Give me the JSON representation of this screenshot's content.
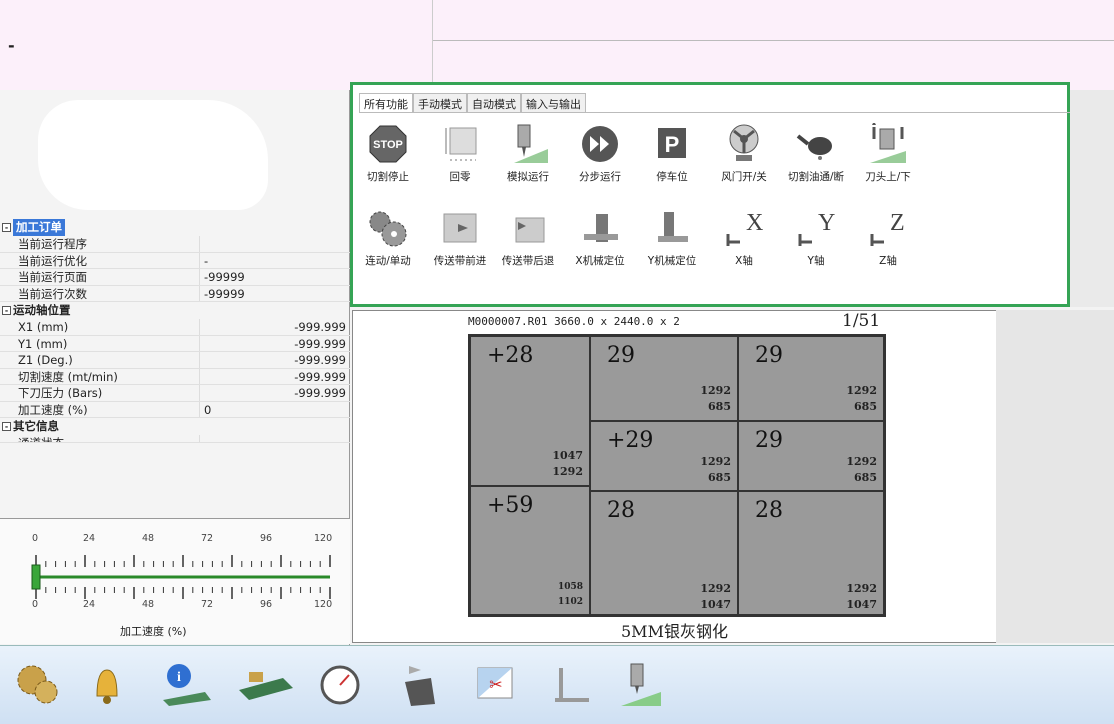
{
  "header": {
    "left_text": "-"
  },
  "tree": {
    "sections": [
      {
        "label": "加工订单",
        "rows": [
          {
            "k": "当前运行程序",
            "v": ""
          },
          {
            "k": "当前运行优化",
            "v": "-"
          },
          {
            "k": "当前运行页面",
            "v": "-99999"
          },
          {
            "k": "当前运行次数",
            "v": "-99999"
          }
        ]
      },
      {
        "label": "运动轴位置",
        "rows": [
          {
            "k": "X1 (mm)",
            "v": "-999.999"
          },
          {
            "k": "Y1 (mm)",
            "v": "-999.999"
          },
          {
            "k": "Z1 (Deg.)",
            "v": "-999.999"
          },
          {
            "k": "切割速度 (mt/min)",
            "v": "-999.999"
          },
          {
            "k": "下刀压力 (Bars)",
            "v": "-999.999"
          },
          {
            "k": "加工速度 (%)",
            "v": "0"
          }
        ]
      },
      {
        "label": "其它信息",
        "rows": [
          {
            "k": "通道状态",
            "v": ""
          }
        ]
      }
    ]
  },
  "gauge": {
    "ticks": [
      "0",
      "24",
      "48",
      "72",
      "96",
      "120"
    ],
    "value": 0,
    "title": "加工速度 (%)"
  },
  "tabs": [
    "所有功能",
    "手动模式",
    "自动模式",
    "输入与输出"
  ],
  "tools_row1": [
    {
      "label": "切割停止",
      "icon": "stop-icon"
    },
    {
      "label": "回零",
      "icon": "home-frame-icon"
    },
    {
      "label": "模拟运行",
      "icon": "simulate-icon"
    },
    {
      "label": "分步运行",
      "icon": "step-run-icon"
    },
    {
      "label": "停车位",
      "icon": "parking-icon"
    },
    {
      "label": "风门开/关",
      "icon": "fan-icon"
    },
    {
      "label": "切割油通/断",
      "icon": "oil-can-icon"
    },
    {
      "label": "刀头上/下",
      "icon": "tool-head-icon"
    }
  ],
  "tools_row2": [
    {
      "label": "连动/单动",
      "icon": "gears-icon"
    },
    {
      "label": "传送带前进",
      "icon": "belt-forward-icon"
    },
    {
      "label": "传送带后退",
      "icon": "belt-back-icon"
    },
    {
      "label": "X机械定位",
      "icon": "x-position-icon"
    },
    {
      "label": "Y机械定位",
      "icon": "y-position-icon"
    },
    {
      "label": "X轴",
      "icon": "x-axis-icon",
      "letter": "X"
    },
    {
      "label": "Y轴",
      "icon": "y-axis-icon",
      "letter": "Y"
    },
    {
      "label": "Z轴",
      "icon": "z-axis-icon",
      "letter": "Z"
    }
  ],
  "sheet": {
    "header": "M0000007.R01    3660.0 x  2440.0 x 2",
    "page": "1/51",
    "footer": "5MM银灰钢化",
    "cells": [
      {
        "num": "+28",
        "d1": "1047",
        "d2": "1292"
      },
      {
        "num": "29",
        "d1": "1292",
        "d2": "685"
      },
      {
        "num": "29",
        "d1": "1292",
        "d2": "685"
      },
      {
        "num": "+29",
        "d1": "1292",
        "d2": "685"
      },
      {
        "num": "29",
        "d1": "1292",
        "d2": "685"
      },
      {
        "num": "+59",
        "d1": "1058",
        "d2": "1102"
      },
      {
        "num": "28",
        "d1": "1292",
        "d2": "1047"
      },
      {
        "num": "28",
        "d1": "1292",
        "d2": "1047"
      }
    ]
  },
  "bottom_bar": [
    "gears-icon",
    "bell-icon",
    "info-icon",
    "machine-icon",
    "gauge-icon",
    "cut-piece-icon",
    "scissors-icon",
    "ruler-icon",
    "tool-head-icon"
  ],
  "colors": {
    "accent_green": "#35a455",
    "selected_blue": "#3a78d8",
    "header_pink": "#fcf0fa"
  }
}
